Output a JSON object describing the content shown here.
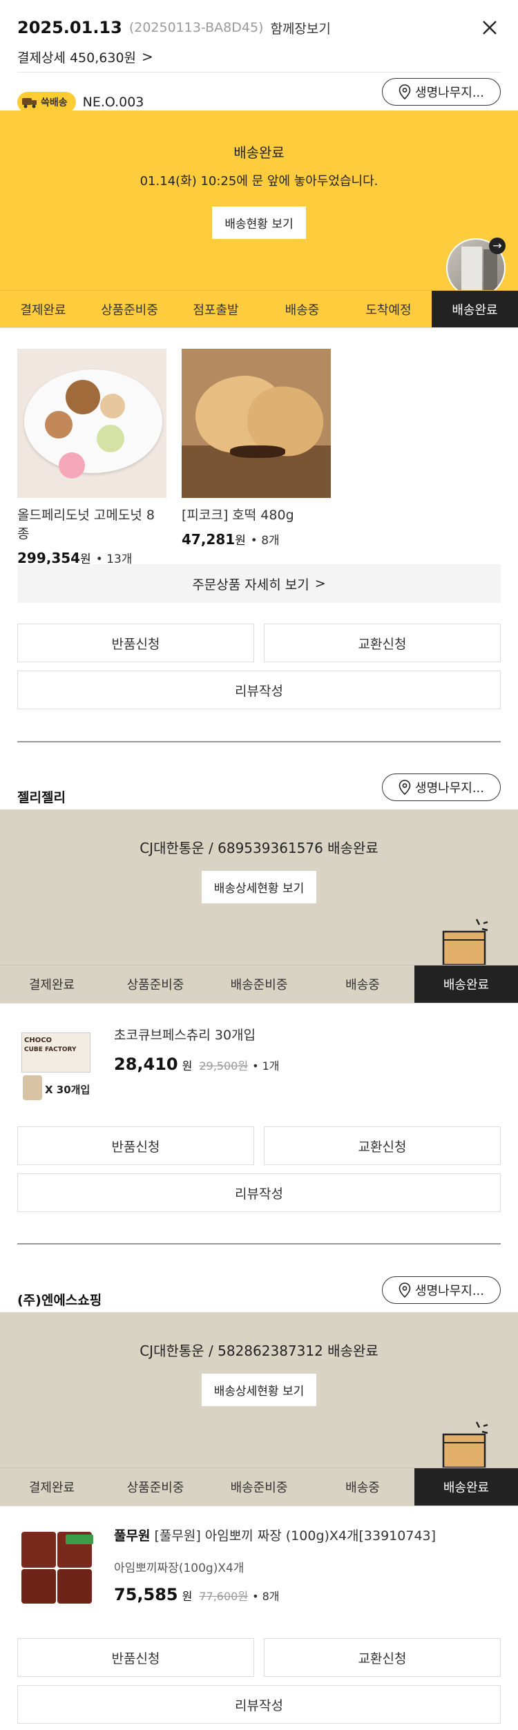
{
  "header": {
    "date": "2025.01.13",
    "order_code": "(20250113-BA8D45)",
    "cart_link": "함께장보기",
    "payment_label": "결제상세 450,630원",
    "chevron": ">"
  },
  "group1": {
    "badge": "쓱배송",
    "store_code": "NE.O.003",
    "address": "생명나무지...",
    "status_title": "배송완료",
    "status_sub": "01.14(화) 10:25에 문 앞에 놓아두었습니다.",
    "status_button": "배송현황 보기",
    "accent": "#ffcc33",
    "tabs": [
      "결제완료",
      "상품준비중",
      "점포출발",
      "배송중",
      "도착예정",
      "배송완료"
    ],
    "products": [
      {
        "name": "올드페리도넛 고메도넛 8종",
        "price": "299,354",
        "won": "원",
        "qty": "• 13개"
      },
      {
        "name": "[피코크] 호떡 480g",
        "price": "47,281",
        "won": "원",
        "qty": "• 8개"
      }
    ],
    "detail_button": "주문상품 자세히 보기",
    "return_button": "반품신청",
    "exchange_button": "교환신청",
    "review_button": "리뷰작성"
  },
  "group2": {
    "seller": "젤리젤리",
    "address": "생명나무지...",
    "status_title": "CJ대한통운 / 689539361576 배송완료",
    "status_button": "배송상세현황 보기",
    "tabs": [
      "결제완료",
      "상품준비중",
      "배송준비중",
      "배송중",
      "배송완료"
    ],
    "item": {
      "name": "초코큐브페스츄리 30개입",
      "price": "28,410",
      "won": "원",
      "orig": "29,500원",
      "qty": "• 1개",
      "thumb_text1": "CHOCO",
      "thumb_text2": "CUBE FACTORY",
      "thumb_text3": "X 30개입"
    },
    "return_button": "반품신청",
    "exchange_button": "교환신청",
    "review_button": "리뷰작성"
  },
  "group3": {
    "seller": "(주)엔에스쇼핑",
    "address": "생명나무지...",
    "status_title": "CJ대한통운 / 582862387312 배송완료",
    "status_button": "배송상세현황 보기",
    "tabs": [
      "결제완료",
      "상품준비중",
      "배송준비중",
      "배송중",
      "배송완료"
    ],
    "item": {
      "brand": "풀무원",
      "name": "[풀무원] 아임뽀끼 짜장 (100g)X4개[33910743]",
      "option": "아임뽀끼짜장(100g)X4개",
      "price": "75,585",
      "won": "원",
      "orig": "77,600원",
      "qty": "• 8개"
    },
    "return_button": "반품신청",
    "exchange_button": "교환신청",
    "review_button": "리뷰작성"
  }
}
